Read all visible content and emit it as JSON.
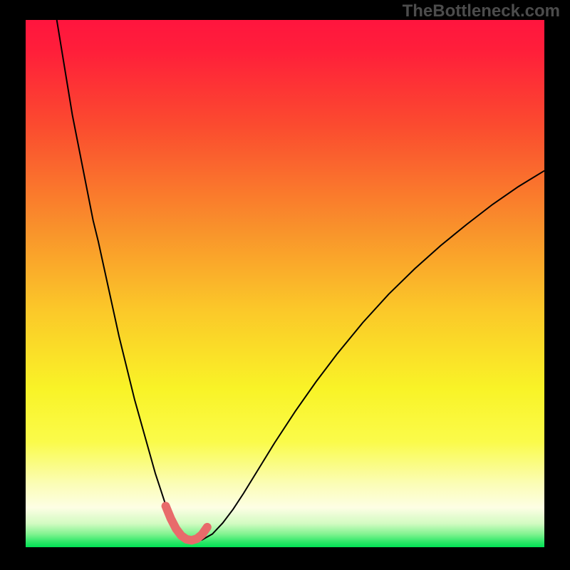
{
  "watermark": "TheBottleneck.com",
  "chart_data": {
    "type": "line",
    "title": "",
    "xlabel": "",
    "ylabel": "",
    "xlim": [
      0,
      100
    ],
    "ylim": [
      0,
      100
    ],
    "gradient_stops": [
      {
        "offset": 0.0,
        "color": "#ff153e"
      },
      {
        "offset": 0.06,
        "color": "#ff1f3a"
      },
      {
        "offset": 0.2,
        "color": "#fb4b2f"
      },
      {
        "offset": 0.4,
        "color": "#f9932b"
      },
      {
        "offset": 0.55,
        "color": "#fbc829"
      },
      {
        "offset": 0.7,
        "color": "#f9f327"
      },
      {
        "offset": 0.8,
        "color": "#fafb4a"
      },
      {
        "offset": 0.88,
        "color": "#fbfdb6"
      },
      {
        "offset": 0.925,
        "color": "#fdfee4"
      },
      {
        "offset": 0.955,
        "color": "#d3fbc2"
      },
      {
        "offset": 0.975,
        "color": "#82f391"
      },
      {
        "offset": 0.99,
        "color": "#2de868"
      },
      {
        "offset": 1.0,
        "color": "#01e254"
      }
    ],
    "series": [
      {
        "name": "curve",
        "color": "#000000",
        "width": 2,
        "x": [
          6,
          7,
          8,
          9,
          10,
          11,
          12,
          13,
          14,
          15,
          16,
          17,
          18,
          19,
          20,
          21,
          22,
          23,
          24,
          25,
          26,
          27,
          28,
          29,
          30,
          31,
          32,
          34,
          36,
          38,
          40,
          42,
          45,
          48,
          52,
          56,
          60,
          65,
          70,
          75,
          80,
          85,
          90,
          95,
          100
        ],
        "y": [
          100,
          94,
          88,
          82,
          77,
          72,
          67,
          62,
          58,
          53.5,
          49,
          44.5,
          40,
          36,
          32,
          28,
          24.5,
          21,
          17.5,
          14,
          11,
          8,
          5.5,
          3.5,
          2.2,
          1.4,
          1.1,
          1.4,
          2.5,
          4.6,
          7.2,
          10.2,
          15,
          19.8,
          25.8,
          31.4,
          36.6,
          42.6,
          48,
          52.8,
          57.2,
          61.2,
          65,
          68.4,
          71.4
        ]
      },
      {
        "name": "highlight",
        "color": "#e86b6b",
        "width": 12,
        "linecap": "round",
        "x": [
          27,
          28,
          29,
          30,
          31,
          32,
          33,
          34,
          35
        ],
        "y": [
          7.8,
          5.4,
          3.5,
          2.2,
          1.5,
          1.3,
          1.6,
          2.4,
          3.8
        ]
      }
    ]
  }
}
